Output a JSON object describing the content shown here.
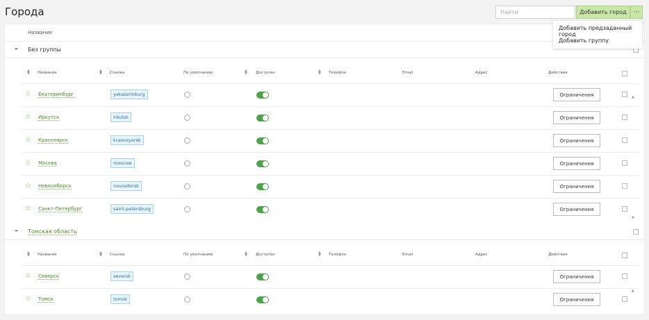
{
  "page": {
    "title": "Города"
  },
  "toolbar": {
    "search_placeholder": "Найти",
    "add_label": "Добавить город",
    "more_label": "···"
  },
  "dropdown": {
    "items": [
      "Добавить предзаданный город",
      "Добавить группу"
    ]
  },
  "top_header": {
    "name_label": "Название"
  },
  "columns": {
    "name": "Название",
    "slug": "Ссылка",
    "default": "По умолчанию",
    "available": "Доступен",
    "phone": "Телефон",
    "email": "Email",
    "address": "Адрес",
    "actions": "Действия"
  },
  "groups": [
    {
      "toggle": "–",
      "name": "Без группы",
      "rows": [
        {
          "name": "Екатеринбург",
          "slug": "yekaterinburg",
          "available": true,
          "action": "Ограничения"
        },
        {
          "name": "Иркутск",
          "slug": "irkutsk",
          "available": true,
          "action": "Ограничения"
        },
        {
          "name": "Красноярск",
          "slug": "krasnoyarsk",
          "available": true,
          "action": "Ограничения"
        },
        {
          "name": "Москва",
          "slug": "moscow",
          "available": true,
          "action": "Ограничения"
        },
        {
          "name": "Новосибирск",
          "slug": "novosibirsk",
          "available": true,
          "action": "Ограничения"
        },
        {
          "name": "Санкт-Петербург",
          "slug": "saint-petersburg",
          "available": true,
          "action": "Ограничения"
        }
      ]
    },
    {
      "toggle": "–",
      "name": "Томская область",
      "rows": [
        {
          "name": "Северск",
          "slug": "seversk",
          "available": true,
          "action": "Ограничения"
        },
        {
          "name": "Томск",
          "slug": "tomsk",
          "available": true,
          "action": "Ограничения"
        }
      ]
    }
  ],
  "colors": {
    "accent_green": "#4a8d26",
    "button_green": "#c9e7a8",
    "switch_on": "#4da34a",
    "slug_blue": "#2a6fa5"
  },
  "icons": {
    "star": "star-icon",
    "sort": "sort-icon",
    "scroll_up": "scroll-up-icon",
    "scroll_down": "scroll-down-icon"
  }
}
